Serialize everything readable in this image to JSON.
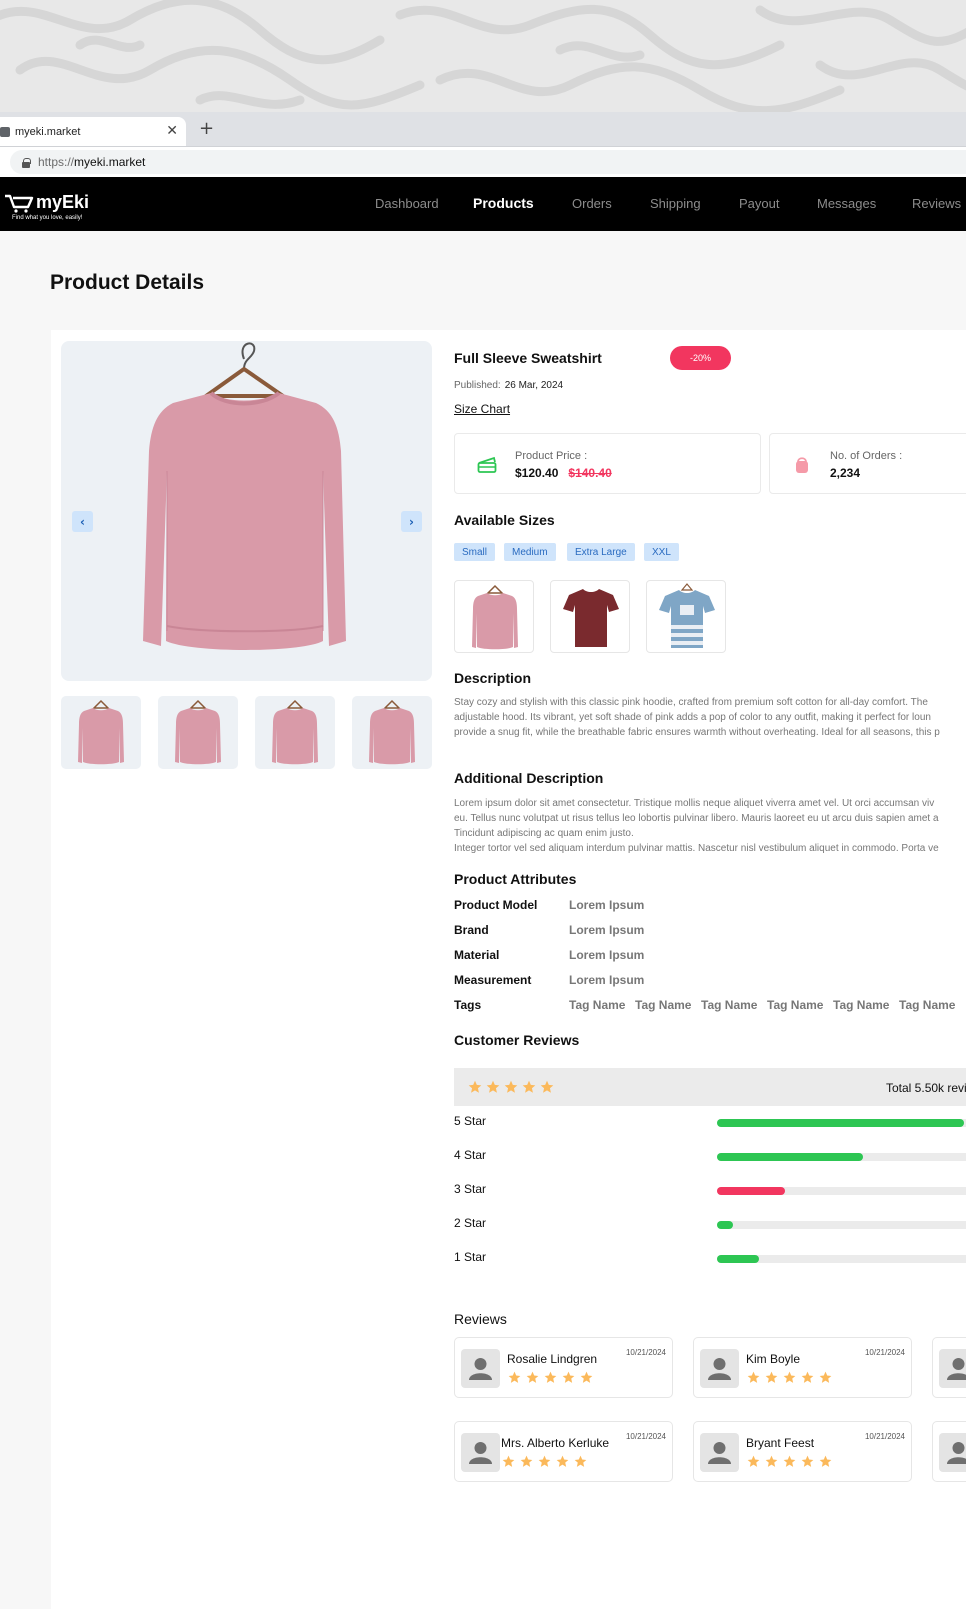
{
  "browser": {
    "tab_title": "myeki.market",
    "url_protocol": "https://",
    "url_host": "myeki.market"
  },
  "app": {
    "logo_text": "myEki",
    "logo_tagline": "Find what you love, easily!",
    "nav": [
      {
        "label": "Dashboard",
        "active": false
      },
      {
        "label": "Products",
        "active": true
      },
      {
        "label": "Orders",
        "active": false
      },
      {
        "label": "Shipping",
        "active": false
      },
      {
        "label": "Payout",
        "active": false
      },
      {
        "label": "Messages",
        "active": false
      },
      {
        "label": "Reviews",
        "active": false
      }
    ]
  },
  "page": {
    "title": "Product Details"
  },
  "product": {
    "name": "Full Sleeve Sweatshirt",
    "discount_badge": "-20%",
    "published_label": "Published:",
    "published_date": "26 Mar, 2024",
    "size_chart_link": "Size Chart",
    "price_label": "Product Price :",
    "price": "$120.40",
    "old_price": "$140.40",
    "orders_label": "No. of Orders :",
    "orders": "2,234",
    "colors": {
      "accent": "#f2365f",
      "chip_bg": "#cfe4fb",
      "chip_text": "#2a6bc0",
      "green": "#2dc653",
      "star": "#fbb95b",
      "garment_pink": "#d99aa8"
    }
  },
  "sizes": {
    "title": "Available Sizes",
    "options": [
      "Small",
      "Medium",
      "Extra Large",
      "XXL"
    ]
  },
  "description": {
    "title": "Description",
    "lines": [
      "Stay cozy and stylish with this classic pink hoodie, crafted from premium soft cotton for all-day comfort. The",
      "adjustable hood. Its vibrant, yet soft shade of pink adds a pop of color to any outfit, making it perfect for loun",
      "provide a snug fit, while the breathable fabric ensures warmth without overheating. Ideal for all seasons, this p"
    ]
  },
  "additional_description": {
    "title": "Additional Description",
    "lines": [
      "Lorem ipsum dolor sit amet consectetur. Tristique mollis neque aliquet viverra amet vel. Ut orci accumsan viv",
      "eu. Tellus nunc volutpat ut risus tellus leo lobortis pulvinar libero. Mauris laoreet eu ut arcu duis sapien amet a",
      "Tincidunt adipiscing ac quam enim justo.",
      "Integer tortor vel sed aliquam interdum pulvinar mattis. Nascetur nisl vestibulum aliquet in commodo. Porta ve"
    ]
  },
  "attributes": {
    "title": "Product Attributes",
    "rows": [
      {
        "key": "Product Model",
        "value": "Lorem Ipsum"
      },
      {
        "key": "Brand",
        "value": "Lorem Ipsum"
      },
      {
        "key": "Material",
        "value": "Lorem Ipsum"
      },
      {
        "key": "Measurement",
        "value": "Lorem Ipsum"
      }
    ],
    "tags_key": "Tags",
    "tags": [
      "Tag Name",
      "Tag Name",
      "Tag Name",
      "Tag Name",
      "Tag Name",
      "Tag Name"
    ]
  },
  "customer_reviews": {
    "title": "Customer Reviews",
    "average_stars": 5,
    "total": "Total 5.50k revie",
    "breakdown": [
      {
        "label": "5 Star",
        "fraction": 0.95,
        "color": "#2dc653"
      },
      {
        "label": "4 Star",
        "fraction": 0.56,
        "color": "#2dc653"
      },
      {
        "label": "3 Star",
        "fraction": 0.26,
        "color": "#f2365f"
      },
      {
        "label": "2 Star",
        "fraction": 0.06,
        "color": "#2dc653"
      },
      {
        "label": "1 Star",
        "fraction": 0.16,
        "color": "#2dc653"
      }
    ],
    "reviews_title": "Reviews",
    "reviews": [
      {
        "name": "Rosalie Lindgren",
        "date": "10/21/2024",
        "stars": 5
      },
      {
        "name": "Kim Boyle",
        "date": "10/21/2024",
        "stars": 5
      },
      {
        "name": "Mrs. Alberto Kerluke",
        "date": "10/21/2024",
        "stars": 5
      },
      {
        "name": "Bryant Feest",
        "date": "10/21/2024",
        "stars": 5
      }
    ]
  }
}
